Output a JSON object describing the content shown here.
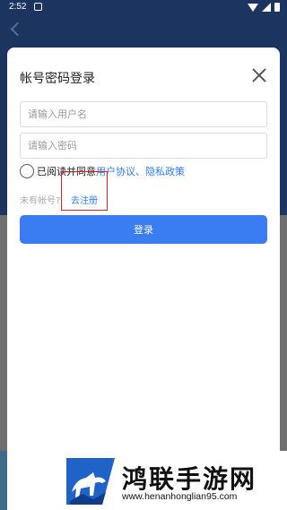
{
  "status_bar": {
    "time": "2:52"
  },
  "dialog": {
    "title": "帐号密码登录",
    "username_placeholder": "请输入用户名",
    "password_placeholder": "请输入密码",
    "agree_text": "已阅读并同意",
    "user_agreement": "用户协议",
    "separator": "、",
    "privacy_policy": "隐私政策",
    "no_account": "未有帐号?",
    "register_label": "去注册",
    "login_label": "登录"
  },
  "watermark": {
    "site_name": "鸿联手游网",
    "url": "www.henanhonglian95.com"
  },
  "colors": {
    "header_bg": "#1c3560",
    "accent": "#3a7cf2",
    "link": "#2f7cf6",
    "highlight_box": "#dd2222"
  }
}
